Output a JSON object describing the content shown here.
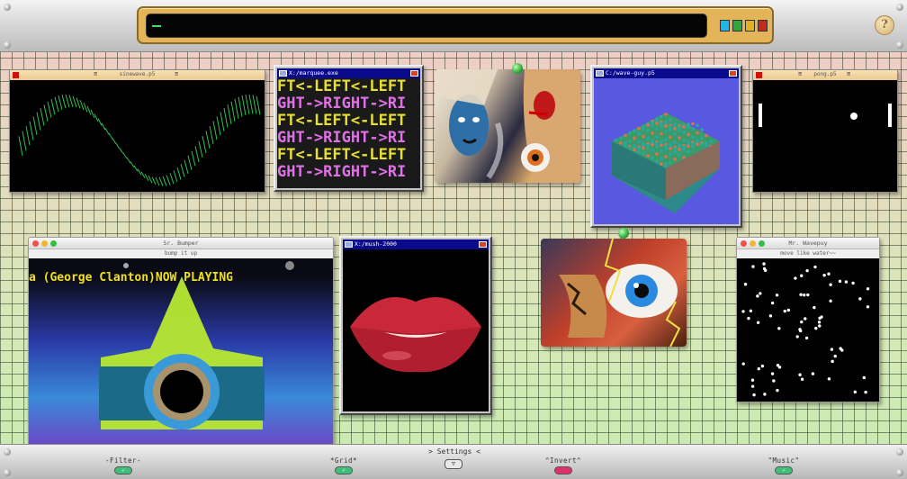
{
  "search": {
    "value": "",
    "swatches": [
      "#1fb6e8",
      "#2fa83a",
      "#e0b020",
      "#c42a1a"
    ]
  },
  "help": {
    "icon": "question-icon",
    "label": "?"
  },
  "windows": {
    "sinewave": {
      "title": "sinewave.p5",
      "ham": "≡"
    },
    "marquee": {
      "title": "X:/marquee.exe",
      "lines": [
        "FT<-LEFT<-LEFT",
        "GHT->RIGHT->RI"
      ]
    },
    "wave_guy": {
      "title": "C:/wave-guy.p5"
    },
    "pong": {
      "title": "pong.p5",
      "ham": "≡"
    },
    "bumper": {
      "title": "Sr. Bumper",
      "subtitle": "bump it up",
      "ticker": "a (George Clanton)NOW PLAYING"
    },
    "mush": {
      "title": "X:/mush-2000"
    },
    "wavepuy": {
      "title": "Mr. Wavepuy",
      "subtitle": "move like water~~"
    }
  },
  "bottom": {
    "settings": "> Settings <",
    "settings_button": "▽",
    "controls": [
      {
        "label": "-Filter-",
        "state": "on",
        "color": "#3ec07a"
      },
      {
        "label": "*Grid*",
        "state": "on",
        "color": "#3ec07a"
      },
      {
        "label": "^Invert^",
        "state": "off",
        "color": "#e0306a"
      },
      {
        "label": "\"Music\"",
        "state": "on",
        "color": "#3ec07a"
      }
    ],
    "toggle_glyph": "✓"
  }
}
